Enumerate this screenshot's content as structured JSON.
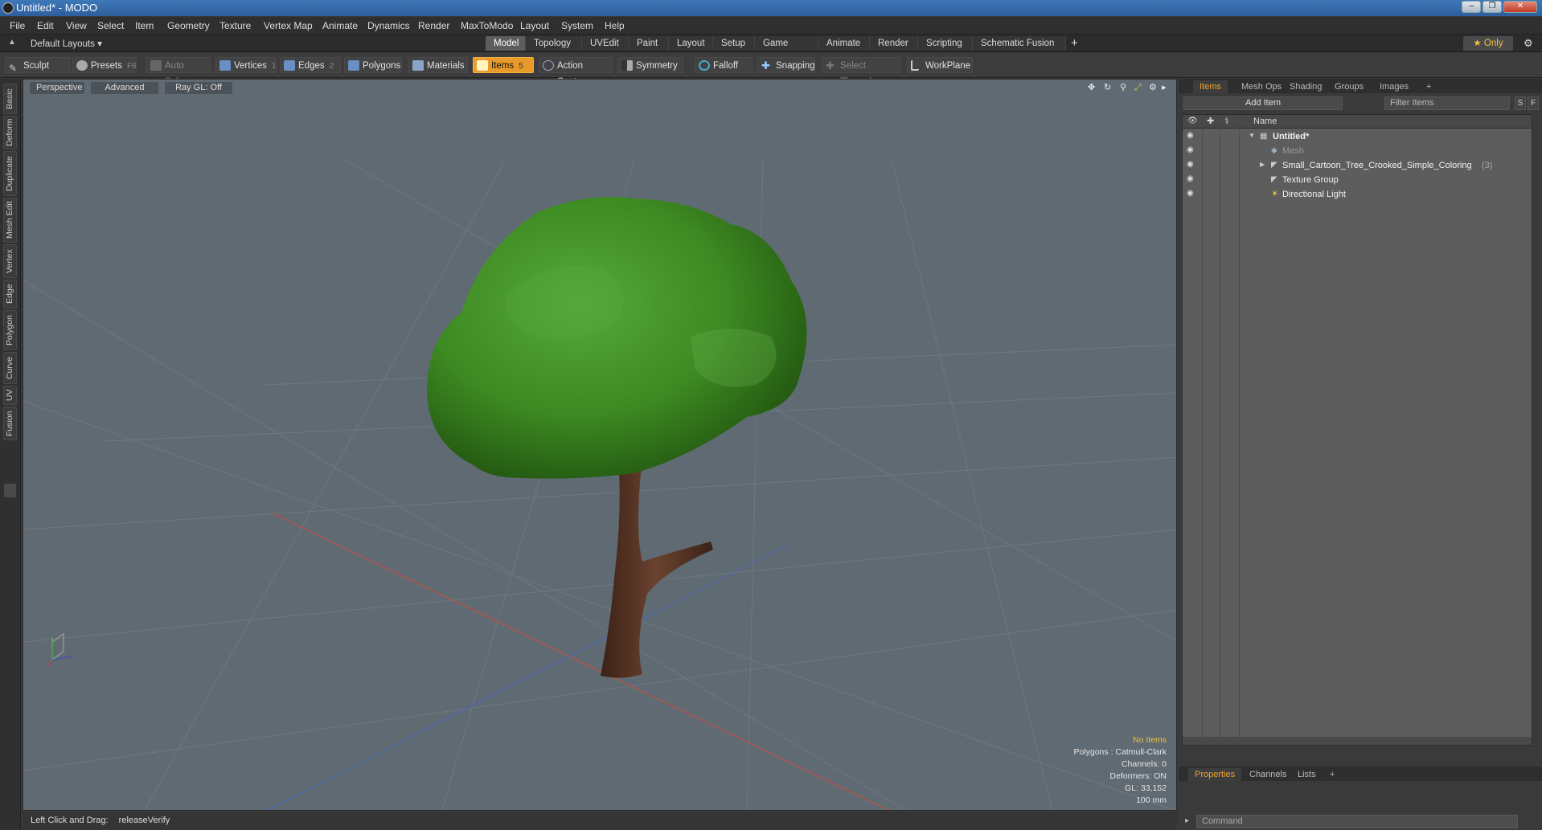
{
  "window": {
    "title": "Untitled* - MODO"
  },
  "menu": [
    "File",
    "Edit",
    "View",
    "Select",
    "Item",
    "Geometry",
    "Texture",
    "Vertex Map",
    "Animate",
    "Dynamics",
    "Render",
    "MaxToModo",
    "Layout",
    "System",
    "Help"
  ],
  "layout": {
    "selector": "Default Layouts ▾",
    "tabs": [
      "Model",
      "Topology",
      "UVEdit",
      "Paint",
      "Layout",
      "Setup",
      "Game Tools",
      "Animate",
      "Render",
      "Scripting",
      "Schematic Fusion"
    ],
    "active_tab": "Model",
    "add": "+",
    "only_label": "★ Only"
  },
  "toolbar": {
    "sculpt": "Sculpt",
    "presets": "Presets",
    "presets_key": "F6",
    "auto_select": "Auto Select",
    "vertices": "Vertices",
    "vertices_key": "1",
    "edges": "Edges",
    "edges_key": "2",
    "polygons": "Polygons",
    "materials": "Materials",
    "items": "Items",
    "items_key": "5",
    "action_center": "Action Center",
    "symmetry": "Symmetry",
    "falloff": "Falloff",
    "snapping": "Snapping",
    "select_through": "Select Through",
    "workplane": "WorkPlane"
  },
  "left_tabs": [
    "Basic",
    "Deform",
    "Duplicate",
    "Mesh Edit",
    "Vertex",
    "Edge",
    "Polygon",
    "Curve",
    "UV",
    "Fusion"
  ],
  "viewport": {
    "view": "Perspective",
    "mode": "Advanced",
    "raygl": "Ray GL: Off",
    "stats": {
      "items": "No Items",
      "polygons": "Polygons : Catmull-Clark",
      "channels": "Channels: 0",
      "deformers": "Deformers: ON",
      "gl": "GL: 33,152",
      "scale": "100 mm"
    },
    "colors": {
      "bg": "#606a72",
      "foliage": "#3d8a22",
      "trunk": "#5a3522",
      "x_axis": "#c0504a",
      "z_axis": "#4a6ab0"
    }
  },
  "status": {
    "hint": "Left Click and Drag:",
    "command": "releaseVerify"
  },
  "items_panel": {
    "tabs": [
      "Items",
      "Mesh Ops",
      "Shading",
      "Groups",
      "Images",
      "+"
    ],
    "add_item": "Add Item",
    "filter_placeholder": "Filter Items",
    "s_btn": "S",
    "f_btn": "F",
    "column_name": "Name",
    "rows": [
      {
        "label": "Untitled*",
        "icon": "scene-icon"
      },
      {
        "label": "Mesh",
        "icon": "mesh-icon"
      },
      {
        "label": "Small_Cartoon_Tree_Crooked_Simple_Coloring",
        "count": "(3)",
        "icon": "locator-icon"
      },
      {
        "label": "Texture Group",
        "icon": "locator-icon"
      },
      {
        "label": "Directional Light",
        "icon": "light-icon"
      }
    ]
  },
  "properties_panel": {
    "tabs": [
      "Properties",
      "Channels",
      "Lists",
      "+"
    ],
    "command_placeholder": "Command"
  }
}
